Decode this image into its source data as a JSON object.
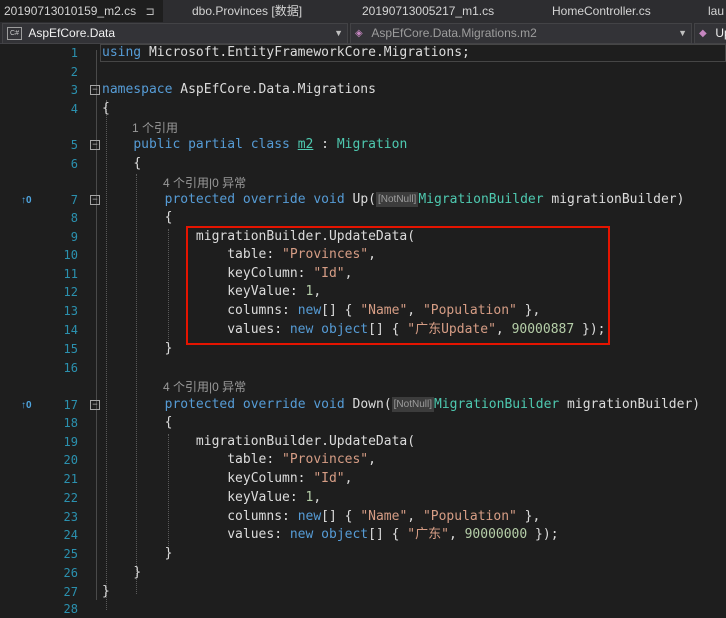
{
  "tabs": [
    {
      "label": "20190713010159_m2.cs",
      "pin": "⊐",
      "close": "✕"
    },
    {
      "label": "dbo.Provinces [数据]"
    },
    {
      "label": "20190713005217_m1.cs"
    },
    {
      "label": "HomeController.cs"
    },
    {
      "label": "lau"
    }
  ],
  "navbar": {
    "project": "AspEfCore.Data",
    "type": "AspEfCore.Data.Migrations.m2",
    "member": "Up"
  },
  "editor": {
    "code_lenses": {
      "line5": "1 个引用",
      "line7": "4 个引用|0 异常",
      "line17": "4 个引用|0 异常"
    },
    "line_numbers": [
      "1",
      "2",
      "3",
      "4",
      "5",
      "6",
      "7",
      "8",
      "9",
      "10",
      "11",
      "12",
      "13",
      "14",
      "15",
      "16",
      "17",
      "18",
      "19",
      "20",
      "21",
      "22",
      "23",
      "24",
      "25",
      "26",
      "27",
      "28"
    ],
    "markers": {
      "up": "↑0",
      "down": "↑0"
    },
    "code": {
      "l1": {
        "kw": "using",
        "rest": " Microsoft.EntityFrameworkCore.Migrations;"
      },
      "l3": {
        "kw": "namespace",
        "rest": " AspEfCore.Data.Migrations"
      },
      "brace_open": "{",
      "brace_close": "}",
      "l5": {
        "kw1": "public",
        "kw2": "partial",
        "kw3": "class",
        "name": "m2",
        "colon": " : ",
        "base": "Migration"
      },
      "l7": {
        "kw1": "protected",
        "kw2": "override",
        "kw3": "void",
        "method": "Up",
        "attr": "[NotNull]",
        "ptype": "MigrationBuilder",
        "pname": " migrationBuilder)"
      },
      "l17": {
        "kw1": "protected",
        "kw2": "override",
        "kw3": "void",
        "method": "Down",
        "attr": "[NotNull]",
        "ptype": "MigrationBuilder",
        "pname": " migrationBuilder)"
      },
      "call": "migrationBuilder.UpdateData(",
      "table_label": "table: ",
      "table_value": "\"Provinces\"",
      "keycol_label": "keyColumn: ",
      "keycol_value": "\"Id\"",
      "keyval_label": "keyValue: ",
      "keyval_value": "1",
      "columns_label": "columns: ",
      "kw_new": "new",
      "kw_object": "object",
      "col_name": "\"Name\"",
      "col_pop": "\"Population\"",
      "values_label": "values: ",
      "up_value_str": "\"广东Update\"",
      "up_value_num": "90000887",
      "down_value_str": "\"广东\"",
      "down_value_num": "90000000"
    }
  },
  "colors": {
    "background": "#1e1e1e",
    "keyword": "#569cd6",
    "type": "#4ec9b0",
    "string": "#d69d85",
    "number": "#b5cea8",
    "line_number": "#2b91af",
    "highlight_box": "#e51400"
  }
}
